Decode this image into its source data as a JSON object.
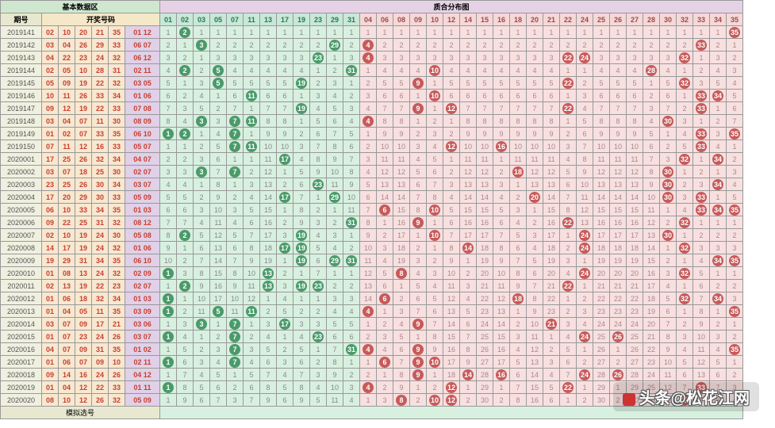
{
  "header": {
    "basic_title": "基本数据区",
    "dist_title": "质合分布图",
    "issue_label": "期号",
    "nums_label": "开奖号码",
    "footer_label": "模拟选号"
  },
  "chart_data": {
    "type": "table",
    "primes": [
      1,
      2,
      3,
      5,
      7,
      11,
      13,
      17,
      19,
      23,
      29,
      31
    ],
    "composites": [
      4,
      6,
      8,
      9,
      10,
      12,
      14,
      15,
      16,
      18,
      20,
      21,
      22,
      24,
      25,
      26,
      27,
      28,
      30,
      32,
      33,
      34,
      35
    ],
    "rows": [
      {
        "issue": "2019141",
        "n": [
          2,
          10,
          20,
          21,
          35
        ],
        "b": "01 12",
        "hits": [
          2,
          35
        ]
      },
      {
        "issue": "2019142",
        "n": [
          3,
          4,
          26,
          29,
          33
        ],
        "b": "06 07",
        "hits": [
          3,
          29,
          4,
          33
        ]
      },
      {
        "issue": "2019143",
        "n": [
          4,
          22,
          23,
          24,
          32
        ],
        "b": "06 12",
        "hits": [
          23,
          4,
          32,
          24,
          22
        ]
      },
      {
        "issue": "2019144",
        "n": [
          2,
          5,
          10,
          28,
          31
        ],
        "b": "02 11",
        "hits": [
          2,
          5,
          31,
          10,
          28
        ]
      },
      {
        "issue": "2019145",
        "n": [
          5,
          9,
          19,
          22,
          32
        ],
        "b": "03 05",
        "hits": [
          5,
          19,
          9,
          22,
          32
        ]
      },
      {
        "issue": "2019146",
        "n": [
          10,
          11,
          26,
          33,
          34
        ],
        "b": "01 06",
        "hits": [
          11,
          10,
          33,
          34
        ]
      },
      {
        "issue": "2019147",
        "n": [
          9,
          12,
          19,
          22,
          33
        ],
        "b": "07 08",
        "hits": [
          19,
          9,
          12,
          22,
          33
        ]
      },
      {
        "issue": "2019148",
        "n": [
          3,
          4,
          7,
          11,
          30
        ],
        "b": "08 09",
        "hits": [
          3,
          7,
          11,
          4,
          30
        ]
      },
      {
        "issue": "2019149",
        "n": [
          1,
          2,
          7,
          33,
          35
        ],
        "b": "06 10",
        "hits": [
          1,
          2,
          7,
          33,
          35
        ]
      },
      {
        "issue": "2019150",
        "n": [
          7,
          11,
          12,
          16,
          33
        ],
        "b": "05 07",
        "hits": [
          7,
          11,
          12,
          16,
          33
        ]
      },
      {
        "issue": "2020001",
        "n": [
          17,
          25,
          26,
          32,
          34
        ],
        "b": "04 07",
        "hits": [
          17,
          34,
          32
        ]
      },
      {
        "issue": "2020002",
        "n": [
          3,
          7,
          18,
          25,
          30
        ],
        "b": "02 07",
        "hits": [
          3,
          7,
          18,
          30
        ]
      },
      {
        "issue": "2020003",
        "n": [
          23,
          25,
          26,
          30,
          34
        ],
        "b": "03 07",
        "hits": [
          23,
          30,
          34
        ]
      },
      {
        "issue": "2020004",
        "n": [
          17,
          20,
          29,
          30,
          33
        ],
        "b": "05 09",
        "hits": [
          17,
          29,
          20,
          33,
          30
        ]
      },
      {
        "issue": "2020005",
        "n": [
          6,
          10,
          33,
          34,
          35
        ],
        "b": "01 03",
        "hits": [
          6,
          10,
          33,
          34,
          35
        ]
      },
      {
        "issue": "2020006",
        "n": [
          9,
          22,
          25,
          31,
          32
        ],
        "b": "08 12",
        "hits": [
          31,
          9,
          22,
          32
        ]
      },
      {
        "issue": "2020007",
        "n": [
          2,
          10,
          19,
          24,
          30
        ],
        "b": "05 08",
        "hits": [
          2,
          19,
          10,
          24,
          30
        ]
      },
      {
        "issue": "2020008",
        "n": [
          14,
          17,
          19,
          24,
          32
        ],
        "b": "01 06",
        "hits": [
          17,
          19,
          14,
          24,
          32
        ]
      },
      {
        "issue": "2020009",
        "n": [
          19,
          29,
          31,
          34,
          35
        ],
        "b": "06 10",
        "hits": [
          19,
          29,
          31,
          34,
          35
        ]
      },
      {
        "issue": "2020010",
        "n": [
          1,
          8,
          13,
          24,
          32
        ],
        "b": "02 09",
        "hits": [
          1,
          13,
          8,
          24,
          32
        ]
      },
      {
        "issue": "2020011",
        "n": [
          2,
          13,
          19,
          22,
          23
        ],
        "b": "02 07",
        "hits": [
          2,
          13,
          19,
          23,
          22
        ]
      },
      {
        "issue": "2020012",
        "n": [
          1,
          6,
          18,
          32,
          34
        ],
        "b": "01 03",
        "hits": [
          1,
          6,
          18,
          32,
          34
        ]
      },
      {
        "issue": "2020013",
        "n": [
          1,
          4,
          5,
          11,
          35
        ],
        "b": "03 09",
        "hits": [
          1,
          5,
          11,
          4,
          35
        ]
      },
      {
        "issue": "2020014",
        "n": [
          3,
          7,
          9,
          17,
          21
        ],
        "b": "03 06",
        "hits": [
          3,
          7,
          17,
          9,
          21
        ]
      },
      {
        "issue": "2020015",
        "n": [
          1,
          7,
          23,
          24,
          26
        ],
        "b": "03 07",
        "hits": [
          1,
          7,
          23,
          24,
          26
        ]
      },
      {
        "issue": "2020016",
        "n": [
          4,
          7,
          9,
          31,
          35
        ],
        "b": "01 02",
        "hits": [
          7,
          31,
          4,
          9,
          35
        ]
      },
      {
        "issue": "2020017",
        "n": [
          1,
          6,
          7,
          9,
          10
        ],
        "b": "02 11",
        "hits": [
          1,
          7,
          6,
          9,
          10
        ]
      },
      {
        "issue": "2020018",
        "n": [
          9,
          14,
          16,
          24,
          26
        ],
        "b": "04 12",
        "hits": [
          9,
          14,
          16,
          24,
          26
        ]
      },
      {
        "issue": "2020019",
        "n": [
          1,
          4,
          12,
          22,
          33
        ],
        "b": "01 11",
        "hits": [
          1,
          4,
          12,
          22,
          33
        ]
      },
      {
        "issue": "2020020",
        "n": [
          8,
          10,
          12,
          26,
          32
        ],
        "b": "05 09",
        "hits": [
          8,
          10,
          12,
          32
        ]
      }
    ]
  },
  "watermark": {
    "text": "头条@松花江网"
  }
}
